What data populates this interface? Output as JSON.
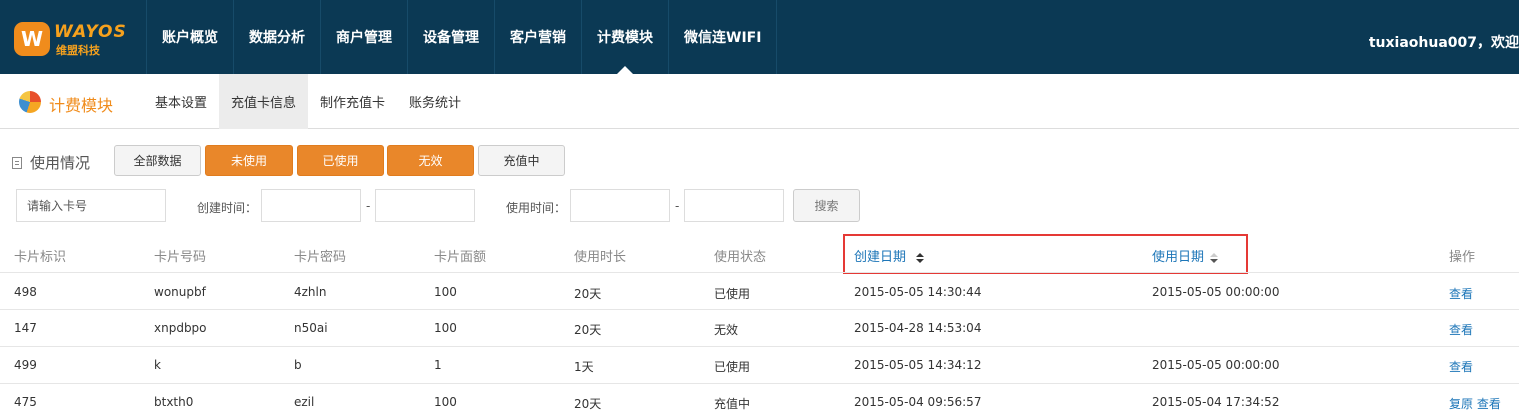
{
  "brand": {
    "name": "WAYOS",
    "sub": "维盟科技",
    "badge": "W"
  },
  "topnav": [
    "账户概览",
    "数据分析",
    "商户管理",
    "设备管理",
    "客户营销",
    "计费模块",
    "微信连WIFI"
  ],
  "user": "tuxiaohua007，欢迎",
  "module": {
    "title": "计费模块",
    "tabs": [
      "基本设置",
      "充值卡信息",
      "制作充值卡",
      "账务统计"
    ]
  },
  "usage": {
    "label": "使用情况",
    "buttons": [
      "全部数据",
      "未使用",
      "已使用",
      "无效",
      "充值中"
    ]
  },
  "filters": {
    "card_placeholder": "请输入卡号",
    "created_label": "创建时间：",
    "used_label": "使用时间：",
    "dash": "-",
    "search": "搜索"
  },
  "table": {
    "headers": [
      "卡片标识",
      "卡片号码",
      "卡片密码",
      "卡片面额",
      "使用时长",
      "使用状态",
      "创建日期",
      "使用日期",
      "操作"
    ],
    "rows": [
      {
        "id": "498",
        "number": "wonupbf",
        "password": "4zhln",
        "amount": "100",
        "duration": "20天",
        "status": "已使用",
        "created": "2015-05-05 14:30:44",
        "used": "2015-05-05 00:00:00",
        "action": "查看"
      },
      {
        "id": "147",
        "number": "xnpdbpo",
        "password": "n50ai",
        "amount": "100",
        "duration": "20天",
        "status": "无效",
        "created": "2015-04-28 14:53:04",
        "used": "",
        "action": "查看"
      },
      {
        "id": "499",
        "number": "k",
        "password": "b",
        "amount": "1",
        "duration": "1天",
        "status": "已使用",
        "created": "2015-05-05 14:34:12",
        "used": "2015-05-05 00:00:00",
        "action": "查看"
      },
      {
        "id": "475",
        "number": "btxth0",
        "password": "ezil",
        "amount": "100",
        "duration": "20天",
        "status": "充值中",
        "created": "2015-05-04 09:56:57",
        "used": "2015-05-04 17:34:52",
        "action": "复原 查看"
      }
    ]
  }
}
